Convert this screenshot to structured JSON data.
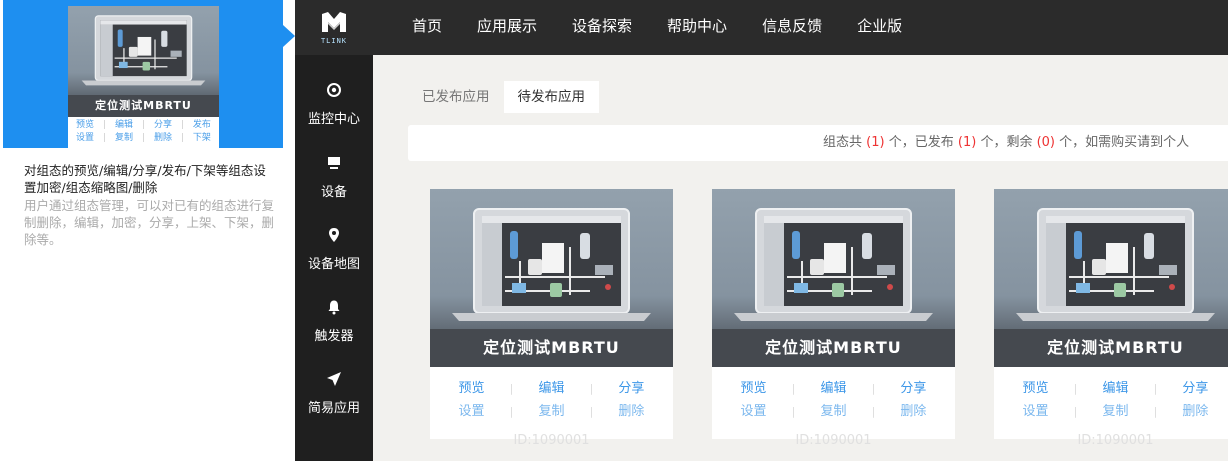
{
  "guide": {
    "card_title": "定位测试MBRTU",
    "actions_row1": [
      "预览",
      "编辑",
      "分享",
      "发布"
    ],
    "actions_row2": [
      "设置",
      "复制",
      "删除",
      "下架"
    ],
    "heading": "对组态的预览/编辑/分享/发布/下架等组态设置加密/组态缩略图/删除",
    "description": "用户通过组态管理，可以对已有的组态进行复制删除，编辑，加密，分享，上架、下架，删除等。"
  },
  "logo": {
    "text": "TLINK",
    "icon": "tlink-logo-icon"
  },
  "nav": {
    "items": [
      "首页",
      "应用展示",
      "设备探索",
      "帮助中心",
      "信息反馈",
      "企业版"
    ]
  },
  "sidebar": {
    "items": [
      {
        "label": "监控中心",
        "icon": "target-icon"
      },
      {
        "label": "设备",
        "icon": "monitor-icon"
      },
      {
        "label": "设备地图",
        "icon": "map-pin-icon"
      },
      {
        "label": "触发器",
        "icon": "bell-icon"
      },
      {
        "label": "简易应用",
        "icon": "send-icon"
      }
    ]
  },
  "tabs": [
    "已发布应用",
    "待发布应用"
  ],
  "info": {
    "p1": "组态共",
    "total": "(1)",
    "p2": "个，已发布",
    "published": "(1)",
    "p3": "个，剩余",
    "remaining": "(0)",
    "p4": "个，如需购买请到个人"
  },
  "cards": [
    {
      "title": "定位测试MBRTU",
      "row1": [
        "预览",
        "编辑",
        "分享"
      ],
      "row2": [
        "设置",
        "复制",
        "删除"
      ],
      "id": "ID:1090001"
    },
    {
      "title": "定位测试MBRTU",
      "row1": [
        "预览",
        "编辑",
        "分享"
      ],
      "row2": [
        "设置",
        "复制",
        "删除"
      ],
      "id": "ID:1090001"
    },
    {
      "title": "定位测试MBRTU",
      "row1": [
        "预览",
        "编辑",
        "分享"
      ],
      "row2": [
        "设置",
        "复制",
        "删除"
      ],
      "id": "ID:1090001"
    }
  ],
  "colors": {
    "accent": "#1e8ff0",
    "link": "#3d97e8",
    "count_red": "#e33333",
    "topbar": "#2b2b2b",
    "sidebar": "#1f1f1f"
  }
}
